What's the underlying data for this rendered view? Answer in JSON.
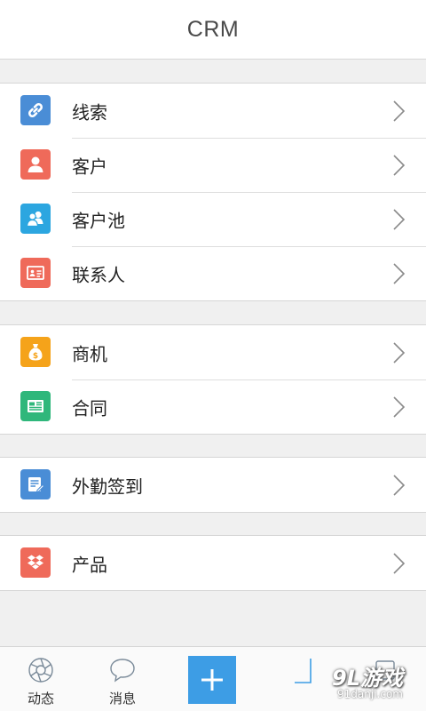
{
  "header": {
    "title": "CRM"
  },
  "colors": {
    "lead": "#4a8dd6",
    "customer": "#ef6a5a",
    "customer_pool": "#2ca6e0",
    "contact": "#ef6a5a",
    "opportunity": "#f5a31a",
    "contract": "#2fb77b",
    "field_checkin": "#4a8dd6",
    "product": "#ef6a5a",
    "primary": "#3d9de5"
  },
  "groups": [
    {
      "items": [
        {
          "label": "线索",
          "icon": "link-icon"
        },
        {
          "label": "客户",
          "icon": "person-icon"
        },
        {
          "label": "客户池",
          "icon": "people-icon"
        },
        {
          "label": "联系人",
          "icon": "contact-card-icon"
        }
      ]
    },
    {
      "items": [
        {
          "label": "商机",
          "icon": "money-bag-icon"
        },
        {
          "label": "合同",
          "icon": "contract-icon"
        }
      ]
    },
    {
      "items": [
        {
          "label": "外勤签到",
          "icon": "checkin-note-icon"
        }
      ]
    },
    {
      "items": [
        {
          "label": "产品",
          "icon": "dropbox-icon"
        }
      ]
    }
  ],
  "tabbar": {
    "tabs": [
      {
        "label": "动态",
        "icon": "aperture-icon"
      },
      {
        "label": "消息",
        "icon": "chat-bubble-icon"
      }
    ],
    "center_button": {
      "icon": "plus-icon"
    }
  },
  "watermark": {
    "logo": "9L游戏",
    "url": "91danji.com"
  }
}
